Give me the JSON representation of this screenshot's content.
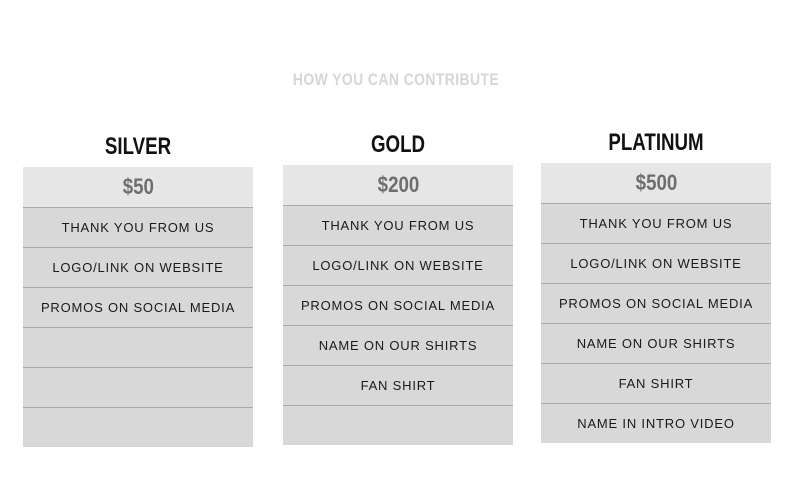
{
  "page": {
    "title": "HOW YOU CAN CONTRIBUTE"
  },
  "tiers": [
    {
      "name": "SILVER",
      "price": "$50",
      "benefits": [
        "THANK YOU FROM US",
        "LOGO/LINK ON WEBSITE",
        "PROMOS ON SOCIAL MEDIA",
        "",
        "",
        ""
      ]
    },
    {
      "name": "GOLD",
      "price": "$200",
      "benefits": [
        "THANK YOU FROM US",
        "LOGO/LINK ON WEBSITE",
        "PROMOS ON SOCIAL MEDIA",
        "NAME ON OUR SHIRTS",
        "FAN SHIRT",
        ""
      ]
    },
    {
      "name": "PLATINUM",
      "price": "$500",
      "benefits": [
        "THANK YOU FROM US",
        "LOGO/LINK ON WEBSITE",
        "PROMOS ON SOCIAL MEDIA",
        "NAME ON OUR SHIRTS",
        "FAN SHIRT",
        "NAME IN INTRO VIDEO"
      ]
    }
  ]
}
